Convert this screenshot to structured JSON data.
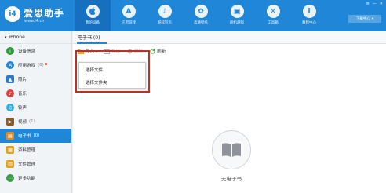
{
  "app": {
    "logo_text": "i4",
    "brand_name": "爱思助手",
    "brand_url": "www.i4.cn"
  },
  "nav": {
    "items": [
      {
        "label": "我的设备",
        "icon": "apple-icon",
        "glyph": ""
      },
      {
        "label": "应用游戏",
        "icon": "appstore-icon",
        "glyph": "A"
      },
      {
        "label": "酷炫铃声",
        "icon": "bell-icon",
        "glyph": "♪"
      },
      {
        "label": "高清壁纸",
        "icon": "wallpaper-icon",
        "glyph": "✿"
      },
      {
        "label": "刷机越狱",
        "icon": "box-icon",
        "glyph": "▣"
      },
      {
        "label": "工具箱",
        "icon": "tools-icon",
        "glyph": "✕"
      },
      {
        "label": "教程中心",
        "icon": "info-icon",
        "glyph": "i"
      }
    ],
    "download_center": "下载中心",
    "download_arrow": "▾"
  },
  "window_controls": {
    "menu": "≡",
    "minimize": "—",
    "close": "✕"
  },
  "sidebar": {
    "device_name": "iPhone",
    "device_arrow": "▾",
    "items": [
      {
        "label": "设备信息",
        "count": "",
        "icon": "device-info-icon",
        "color": "#2e9b3a",
        "glyph": "i"
      },
      {
        "label": "应用游戏",
        "count": "(8)",
        "icon": "apps-icon",
        "color": "#1f86d8",
        "glyph": "A"
      },
      {
        "label": "照片",
        "count": "",
        "icon": "photos-icon",
        "color": "#2f79c9",
        "glyph": "▲"
      },
      {
        "label": "音乐",
        "count": "",
        "icon": "music-icon",
        "color": "#e0403a",
        "glyph": "♪"
      },
      {
        "label": "铃声",
        "count": "",
        "icon": "ringtone-icon",
        "color": "#2eaee0",
        "glyph": "♫"
      },
      {
        "label": "视频",
        "count": "(1)",
        "icon": "video-icon",
        "color": "#8a5a2b",
        "glyph": "▶"
      },
      {
        "label": "电子书",
        "count": "(0)",
        "icon": "ebook-icon",
        "color": "#e08a1f",
        "glyph": "▤"
      },
      {
        "label": "资料管理",
        "count": "",
        "icon": "data-icon",
        "color": "#e0a020",
        "glyph": "▦"
      },
      {
        "label": "文件管理",
        "count": "",
        "icon": "file-icon",
        "color": "#e0a020",
        "glyph": "▥"
      },
      {
        "label": "更多功能",
        "count": "",
        "icon": "more-icon",
        "color": "#3a9a45",
        "glyph": "⋯"
      }
    ]
  },
  "main": {
    "tab_label": "电子书 (0)",
    "toolbar": {
      "import": "导入",
      "export": "导出",
      "delete": "删除",
      "refresh": "刷新"
    },
    "import_menu": [
      "选择文件",
      "选择文件夹"
    ],
    "empty_text": "无电子书"
  },
  "colors": {
    "brand_blue": "#1f86d8",
    "highlight_red": "#c0302a"
  }
}
